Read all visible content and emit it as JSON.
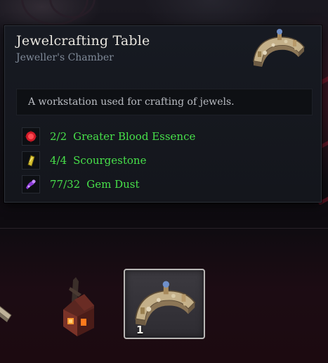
{
  "tooltip": {
    "title": "Jewelcrafting Table",
    "subtitle": "Jeweller's Chamber",
    "description": "A workstation used for crafting of jewels.",
    "requirements": [
      {
        "count": "2/2",
        "name": "Greater Blood Essence",
        "icon": "blood-essence-icon"
      },
      {
        "count": "4/4",
        "name": "Scourgestone",
        "icon": "scourgestone-icon"
      },
      {
        "count": "77/32",
        "name": "Gem Dust",
        "icon": "gem-dust-icon"
      }
    ],
    "requirement_color": "#47e04a"
  },
  "hotbar": {
    "slots": [
      {
        "item": "partial-item-icon"
      },
      {
        "item": "furnace-item-icon"
      },
      {
        "item": "jewelcrafting-table-icon",
        "count": "1",
        "selected": true
      }
    ]
  }
}
